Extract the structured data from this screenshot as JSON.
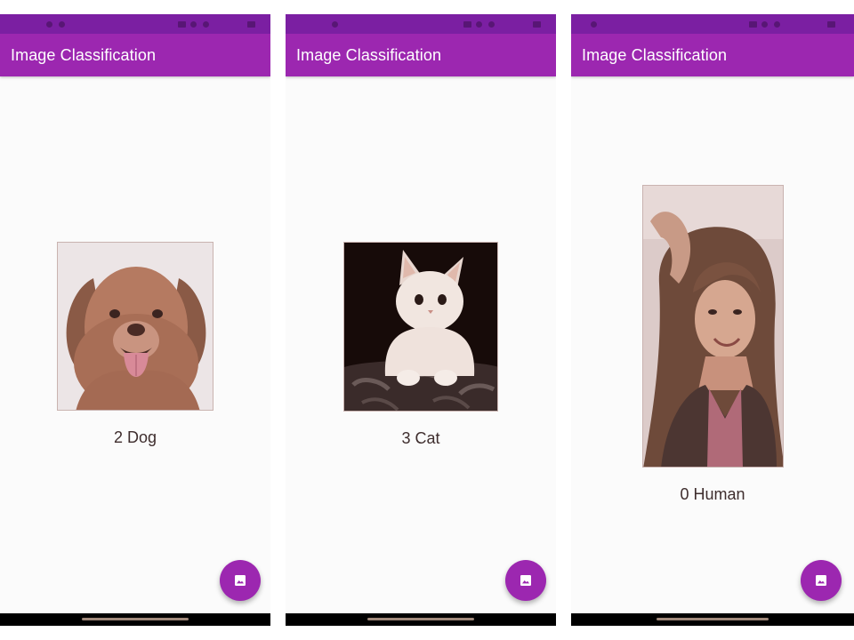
{
  "colors": {
    "status_bar": "#7b1fa2",
    "app_bar": "#9c27b0",
    "fab": "#9c27b0",
    "background": "#fbfbfb",
    "nav_bar": "#000000"
  },
  "screens": [
    {
      "app_title": "Image Classification",
      "image_subject": "dog",
      "result_label": "2 Dog",
      "fab_icon": "image-icon"
    },
    {
      "app_title": "Image Classification",
      "image_subject": "cat",
      "result_label": "3 Cat",
      "fab_icon": "image-icon"
    },
    {
      "app_title": "Image Classification",
      "image_subject": "human",
      "result_label": "0 Human",
      "fab_icon": "image-icon"
    }
  ]
}
